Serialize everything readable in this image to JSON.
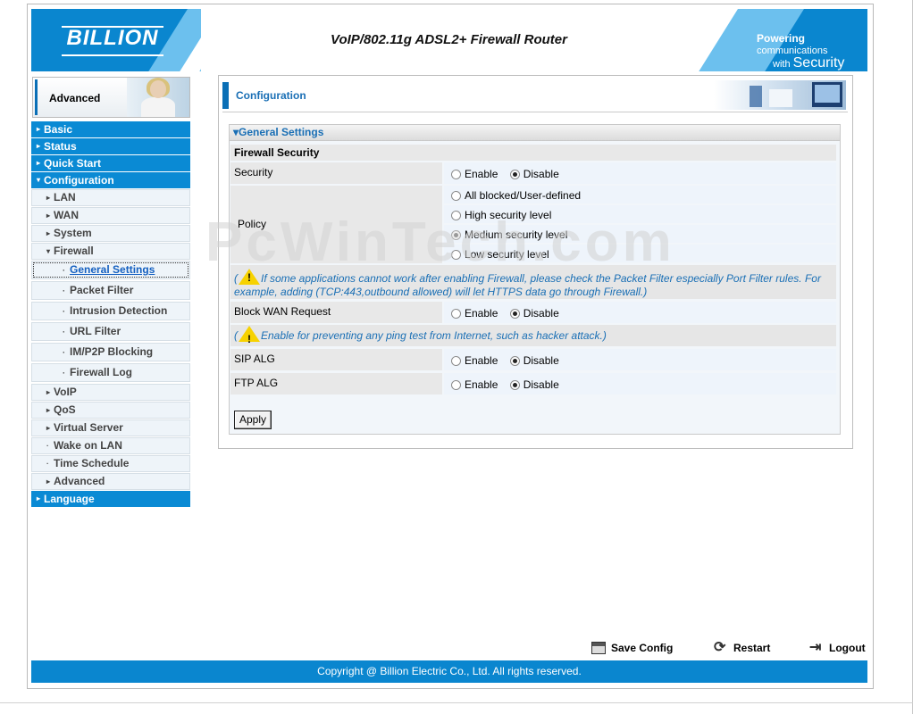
{
  "header": {
    "logo_text": "BILLION",
    "title": "VoIP/802.11g ADSL2+ Firewall Router",
    "tagline_bold": "Powering",
    "tagline_small": "communications",
    "tagline_with": "with",
    "tagline_security": "Security"
  },
  "left": {
    "mode_label": "Advanced",
    "menu": [
      {
        "label": "Basic",
        "level": "top",
        "arrow": "▸"
      },
      {
        "label": "Status",
        "level": "top",
        "arrow": "▸"
      },
      {
        "label": "Quick Start",
        "level": "top",
        "arrow": "▸"
      },
      {
        "label": "Configuration",
        "level": "top",
        "arrow": "▾"
      },
      {
        "label": "LAN",
        "level": "sub",
        "arrow": "▸"
      },
      {
        "label": "WAN",
        "level": "sub",
        "arrow": "▸"
      },
      {
        "label": "System",
        "level": "sub",
        "arrow": "▸"
      },
      {
        "label": "Firewall",
        "level": "sub",
        "arrow": "▾"
      },
      {
        "label": "General Settings",
        "level": "sub2",
        "active": true
      },
      {
        "label": "Packet Filter",
        "level": "sub2"
      },
      {
        "label": "Intrusion Detection",
        "level": "sub2"
      },
      {
        "label": "URL Filter",
        "level": "sub2"
      },
      {
        "label": "IM/P2P Blocking",
        "level": "sub2"
      },
      {
        "label": "Firewall Log",
        "level": "sub2"
      },
      {
        "label": "VoIP",
        "level": "sub",
        "arrow": "▸"
      },
      {
        "label": "QoS",
        "level": "sub",
        "arrow": "▸"
      },
      {
        "label": "Virtual Server",
        "level": "sub",
        "arrow": "▸"
      },
      {
        "label": "Wake on LAN",
        "level": "sub",
        "arrow": "·"
      },
      {
        "label": "Time Schedule",
        "level": "sub",
        "arrow": "·"
      },
      {
        "label": "Advanced",
        "level": "sub",
        "arrow": "▸"
      },
      {
        "label": "Language",
        "level": "top",
        "arrow": "▸"
      }
    ]
  },
  "panel": {
    "title": "Configuration",
    "section": "General Settings",
    "section_arrow": "▾",
    "group_title": "Firewall Security",
    "security": {
      "label": "Security",
      "enable": "Enable",
      "disable": "Disable",
      "selected": "disable"
    },
    "policy": {
      "label": "Policy",
      "options": [
        {
          "label": "All blocked/User-defined",
          "selected": false,
          "disabled": false
        },
        {
          "label": "High security level",
          "selected": false,
          "disabled": false
        },
        {
          "label": "Medium security level",
          "selected": true,
          "disabled": true
        },
        {
          "label": "Low security level",
          "selected": false,
          "disabled": false
        }
      ]
    },
    "note1": "If some applications cannot work after enabling Firewall, please check the Packet Filter especially Port Filter rules. For example, adding (TCP:443,outbound allowed) will let HTTPS data go through Firewall.)",
    "note_open": "(",
    "block_wan": {
      "label": "Block WAN Request",
      "enable": "Enable",
      "disable": "Disable",
      "selected": "disable"
    },
    "note2": "Enable for preventing any ping test from Internet, such as hacker attack.)",
    "sip_alg": {
      "label": "SIP ALG",
      "enable": "Enable",
      "disable": "Disable",
      "selected": "disable"
    },
    "ftp_alg": {
      "label": "FTP ALG",
      "enable": "Enable",
      "disable": "Disable",
      "selected": "disable"
    },
    "apply_label": "Apply"
  },
  "watermark": "PcWinTech.com",
  "footer": {
    "save_label": "Save Config",
    "restart_label": "Restart",
    "logout_label": "Logout",
    "copyright": "Copyright @ Billion Electric Co., Ltd. All rights reserved."
  },
  "colors": {
    "brand_blue": "#0a86cf",
    "link_blue": "#1a6fb5"
  }
}
